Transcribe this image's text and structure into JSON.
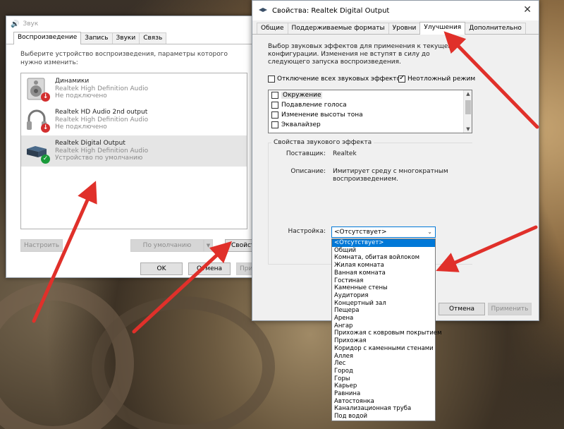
{
  "sound_window": {
    "title": "Звук",
    "tabs": [
      "Воспроизведение",
      "Запись",
      "Звуки",
      "Связь"
    ],
    "instruction": "Выберите устройство воспроизведения, параметры которого нужно изменить:",
    "devices": [
      {
        "name": "Динамики",
        "driver": "Realtek High Definition Audio",
        "status": "Не подключено",
        "icon": "speaker-icon",
        "badge": "disconnected"
      },
      {
        "name": "Realtek HD Audio 2nd output",
        "driver": "Realtek High Definition Audio",
        "status": "Не подключено",
        "icon": "headphones-icon",
        "badge": "disconnected"
      },
      {
        "name": "Realtek Digital Output",
        "driver": "Realtek High Definition Audio",
        "status": "Устройство по умолчанию",
        "icon": "digital-output-icon",
        "badge": "default"
      }
    ],
    "buttons": {
      "configure": "Настроить",
      "default": "По умолчанию",
      "properties": "Свойства",
      "ok": "OK",
      "cancel": "Отмена",
      "apply": "Применить"
    }
  },
  "properties_window": {
    "title": "Свойства: Realtek Digital Output",
    "tabs": [
      "Общие",
      "Поддерживаемые форматы",
      "Уровни",
      "Улучшения",
      "Дополнительно"
    ],
    "active_tab": "Улучшения",
    "instruction": "Выбор звуковых эффектов для применения к текущей конфигурации. Изменения не вступят в силу до следующего запуска воспроизведения.",
    "disable_all_label": "Отключение всех звуковых эффектов",
    "disable_all_checked": false,
    "immediate_label": "Неотложный режим",
    "immediate_checked": true,
    "effects": [
      "Окружение",
      "Подавление голоса",
      "Изменение высоты тона",
      "Эквалайзер"
    ],
    "effect_props": {
      "legend": "Свойства звукового эффекта",
      "provider_label": "Поставщик:",
      "provider_value": "Realtek",
      "description_label": "Описание:",
      "description_value": "Имитирует среду с многократным воспроизведением.",
      "setting_label": "Настройка:",
      "setting_value": "<Отсутствует>"
    },
    "buttons": {
      "cancel": "Отмена",
      "apply": "Применить"
    }
  },
  "dropdown_options": [
    "<Отсутствует>",
    "Общий",
    "Комната, обитая войлоком",
    "Жилая комната",
    "Ванная комната",
    "Гостиная",
    "Каменные стены",
    "Аудитория",
    "Концертный зал",
    "Пещера",
    "Арена",
    "Ангар",
    "Прихожая с ковровым покрытием",
    "Прихожая",
    "Коридор с каменными стенами",
    "Аллея",
    "Лес",
    "Город",
    "Горы",
    "Карьер",
    "Равнина",
    "Автостоянка",
    "Канализационная труба",
    "Под водой"
  ],
  "colors": {
    "selection_blue": "#0078d7",
    "arrow_red": "#e0302a",
    "status_red": "#d32f2f",
    "status_green": "#1a9a3a"
  }
}
